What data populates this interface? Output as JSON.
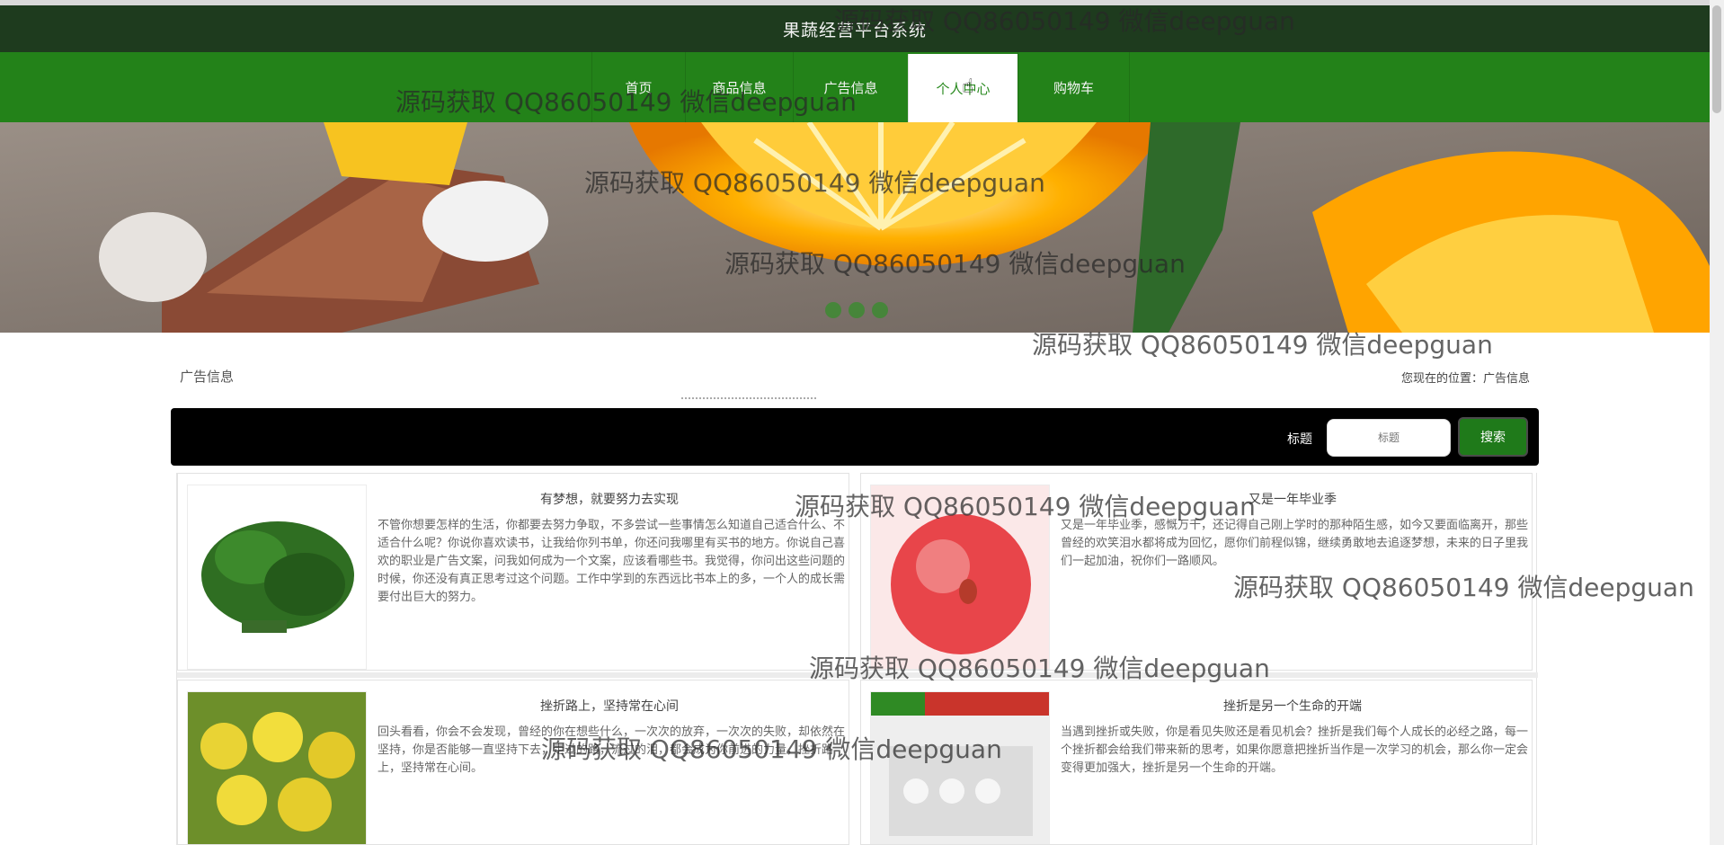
{
  "app": {
    "title": "果蔬经营平台系统"
  },
  "nav": {
    "items": [
      {
        "label": "首页"
      },
      {
        "label": "商品信息"
      },
      {
        "label": "广告信息"
      },
      {
        "label": "个人中心"
      },
      {
        "label": "购物车"
      }
    ],
    "active_index": 3
  },
  "banner": {
    "dots": 3
  },
  "section": {
    "title": "广告信息",
    "breadcrumb": "您现在的位置：广告信息"
  },
  "search": {
    "label": "标题",
    "placeholder": "标题",
    "button": "搜索"
  },
  "cards": [
    {
      "title": "有梦想，就要努力去实现",
      "body": "不管你想要怎样的生活，你都要去努力争取，不多尝试一些事情怎么知道自己适合什么、不适合什么呢？你说你喜欢读书，让我给你列书单，你还问我哪里有买书的地方。你说自己喜欢的职业是广告文案，问我如何成为一个文案，应该看哪些书。我觉得，你问出这些问题的时候，你还没有真正思考过这个问题。工作中学到的东西远比书本上的多，一个人的成长需要付出巨大的努力。",
      "thumb": "green-vegetable",
      "accent": "#2f6e22"
    },
    {
      "title": "又是一年毕业季",
      "body": "又是一年毕业季，感慨万千，还记得自己刚上学时的那种陌生感，如今又要面临离开，那些曾经的欢笑泪水都将成为回忆，愿你们前程似锦，继续勇敢地去追逐梦想，未来的日子里我们一起加油，祝你们一路顺风。",
      "thumb": "red-apple",
      "accent": "#e8454a"
    },
    {
      "title": "挫折路上，坚持常在心间",
      "body": "回头看看，你会不会发现，曾经的你在想些什么，一次次的放弃，一次次的失败，却依然在坚持，你是否能够一直坚持下去，走过的路，流过的泪，都会成为你前进的力量，挫折路上，坚持常在心间。",
      "thumb": "yellow-lemons",
      "accent": "#d8c42a"
    },
    {
      "title": "挫折是另一个生命的开端",
      "body": "当遇到挫折或失败，你是看见失败还是看见机会？挫折是我们每个人成长的必经之路，每一个挫折都会给我们带来新的思考，如果你愿意把挫折当作是一次学习的机会，那么你一定会变得更加强大，挫折是另一个生命的开端。",
      "thumb": "boxed-produce",
      "accent": "#c9342b"
    }
  ],
  "watermark": "源码获取 QQ86050149 微信deepguan",
  "colors": {
    "header_dark": "#1e3b1e",
    "nav_green": "#238219",
    "search_bg": "#000000",
    "button_green": "#1f7a1a"
  }
}
